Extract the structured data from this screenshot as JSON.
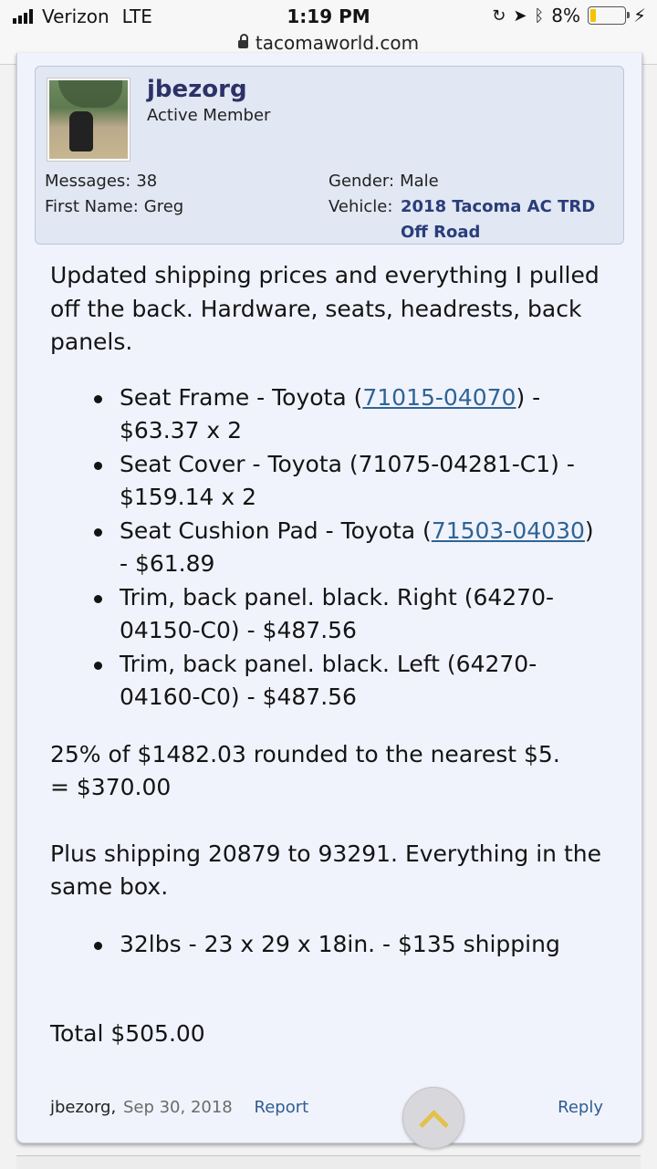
{
  "status_bar": {
    "carrier": "Verizon",
    "network": "LTE",
    "time": "1:19 PM",
    "battery_pct": "8%",
    "battery_level": 0.08,
    "url": "tacomaworld.com"
  },
  "user": {
    "name": "jbezorg",
    "title": "Active Member",
    "messages_label": "Messages:",
    "messages_value": "38",
    "first_name_label": "First Name:",
    "first_name_value": "Greg",
    "gender_label": "Gender:",
    "gender_value": "Male",
    "vehicle_label": "Vehicle:",
    "vehicle_value": "2018 Tacoma AC TRD Off Road"
  },
  "post": {
    "intro": "Updated shipping prices and everything I pulled off the back. Hardware, seats, headrests, back panels.",
    "items": [
      {
        "before": "Seat Frame - Toyota (",
        "link": "71015-04070",
        "after": ") - $63.37 x 2"
      },
      {
        "before": "Seat Cover - Toyota (71075-04281-C1) - $159.14 x 2",
        "link": "",
        "after": ""
      },
      {
        "before": "Seat Cushion Pad - Toyota (",
        "link": "71503-04030",
        "after": ") - $61.89"
      },
      {
        "before": "Trim, back panel. black. Right (64270-04150-C0) - $487.56",
        "link": "",
        "after": ""
      },
      {
        "before": "Trim, back panel. black. Left (64270-04160-C0) - $487.56",
        "link": "",
        "after": ""
      }
    ],
    "calc_line1": "25% of $1482.03 rounded to the nearest $5.",
    "calc_line2": "= $370.00",
    "shipping_text": "Plus shipping 20879 to 93291. Everything in the same box.",
    "shipping_item": "32lbs - 23 x 29 x 18in. - $135 shipping",
    "total": "Total $505.00"
  },
  "footer": {
    "author": "jbezorg",
    "date": "Sep 30, 2018",
    "report": "Report",
    "reply": "Reply"
  },
  "icons": {
    "scroll_top": "chevron-up-icon",
    "lock": "lock-icon",
    "signal": "signal-bars-icon",
    "battery": "battery-icon"
  }
}
